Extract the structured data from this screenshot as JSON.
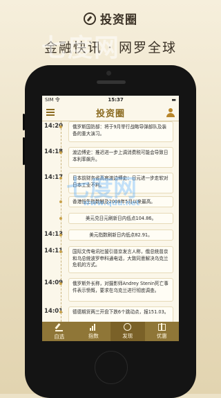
{
  "promo": {
    "app_title": "投资圈",
    "tagline": "金融快讯 · 网罗全球",
    "watermark_top": "七度网",
    "watermark_mid": "七度网",
    "watermark_url": "www.qdu.net"
  },
  "status_bar": {
    "carrier": "SIM 令",
    "time": "15:37",
    "battery": "▬"
  },
  "navbar": {
    "title": "投资圈"
  },
  "timeline": [
    {
      "time": "14:20",
      "text": "俄罗斯国防部：将于9月举行战略导弹部队及装备的重大演习。"
    },
    {
      "time": "14:18",
      "text": "渡边博史：推迟进一步上调消费税可能会导致日本利率飙升。"
    },
    {
      "time": "14:17",
      "text": "日本前财务省高官渡边博史：日元进一步走软对日本工业不利。"
    },
    {
      "time": "",
      "text": "香港恒生指数触及2008年5月以来最高。"
    },
    {
      "time": "",
      "text": "美元兑日元刷新日内低点104.86。"
    },
    {
      "time": "14:13",
      "text": "美元指数刷新日内低点82.91。"
    },
    {
      "time": "14:11",
      "text": "国际文传电讯社援引普京发言人称，俄总统普京和乌总统波罗申科通电话，大致同意解决乌克兰危机的方式。"
    },
    {
      "time": "14:09",
      "text": "俄罗斯外长称，对摄影师Andrey Stenin死亡事件表示愤慨，要求在乌克兰进行彻底调查。"
    },
    {
      "time": "14:01",
      "text": "德德期货两三开盘下跌6个跳动点，报151.03。"
    }
  ],
  "tabs": [
    {
      "label": "自选",
      "icon": "pencil-icon"
    },
    {
      "label": "指数",
      "icon": "chart-icon"
    },
    {
      "label": "发现",
      "icon": "compass-icon"
    },
    {
      "label": "优惠",
      "icon": "gift-icon"
    }
  ]
}
